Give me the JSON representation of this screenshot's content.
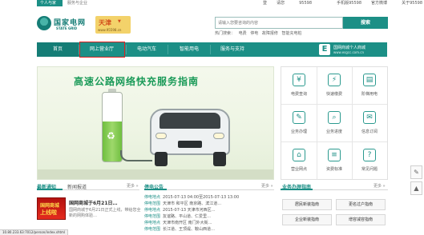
{
  "top_bar": {
    "tab_personal": "个人与家庭",
    "tab_business": "服务与企业",
    "link_login": "登",
    "link_register": "请您",
    "hotline": "95598",
    "mobile_label": "手机版95598",
    "weibo_label": "官方微博",
    "about_label": "关于95598"
  },
  "header": {
    "logo_cn": "国家电网",
    "logo_en": "STATE GRID",
    "city_name": "天津",
    "city_arrow": "▼",
    "city_url": "www.95598.cn",
    "search_placeholder": "请输入您要咨询的内容",
    "search_button": "搜索",
    "hot_search": [
      "热门搜索：",
      "电费",
      "停电",
      "故障报修",
      "智能充电桩"
    ]
  },
  "nav": {
    "items": [
      "首页",
      "网上营业厅",
      "电动汽车",
      "智能用电",
      "服务与支持"
    ],
    "mall_logo": "E",
    "mall_title": "国网商城个人商城",
    "mall_url": "www.esgcc.com.cn"
  },
  "banner": {
    "title": "高速公路网络快充服务指南",
    "recycle_icon": "♻"
  },
  "services": [
    {
      "label": "电费查询",
      "icon": "¥"
    },
    {
      "label": "快速缴费",
      "icon": "⚡"
    },
    {
      "label": "阶梯用电",
      "icon": "▤"
    },
    {
      "label": "业务办理",
      "icon": "✎"
    },
    {
      "label": "业务进度",
      "icon": "⌕"
    },
    {
      "label": "信息订阅",
      "icon": "✉"
    },
    {
      "label": "营业网点",
      "icon": "⌂"
    },
    {
      "label": "资费标准",
      "icon": "≡"
    },
    {
      "label": "常见问题",
      "icon": "?"
    }
  ],
  "news": {
    "tab_latest": "最新通知",
    "tab_news": "新闻报道",
    "more": "更多 »",
    "thumb_line1": "国网商城",
    "thumb_line2": "上线啦",
    "headline": "国网商城于6月21日…",
    "body": "国网商城于6月21日正式上线，带给您全新的网购体验…"
  },
  "notices": {
    "title": "停电公告",
    "more": "更多 »",
    "rows": [
      {
        "tag": "停电地点",
        "text": "2015-07-13 04:00至2015-07-13 13:00"
      },
      {
        "tag": "停电范围",
        "text": "天津市 和平区 南京路、滨江道…"
      },
      {
        "tag": "停电地点",
        "text": "2015-07-13 天津市河西区…"
      },
      {
        "tag": "停电范围",
        "text": "友谊路、平山道、仁爱里…"
      },
      {
        "tag": "停电地点",
        "text": "天津市南开区 南门外大街…"
      },
      {
        "tag": "停电范围",
        "text": "长江道、王顶堤、鞍山西道…"
      }
    ]
  },
  "business": {
    "title": "业务办理指南",
    "more": "更多 »",
    "buttons": [
      "居民新装指南",
      "更名过户指南",
      "企业新装指南",
      "增容减容指南"
    ]
  },
  "status_url": "10.80.233.63:7012/person/index.shtml",
  "side_tools": {
    "edit_icon": "✎",
    "top_icon": "▲"
  }
}
